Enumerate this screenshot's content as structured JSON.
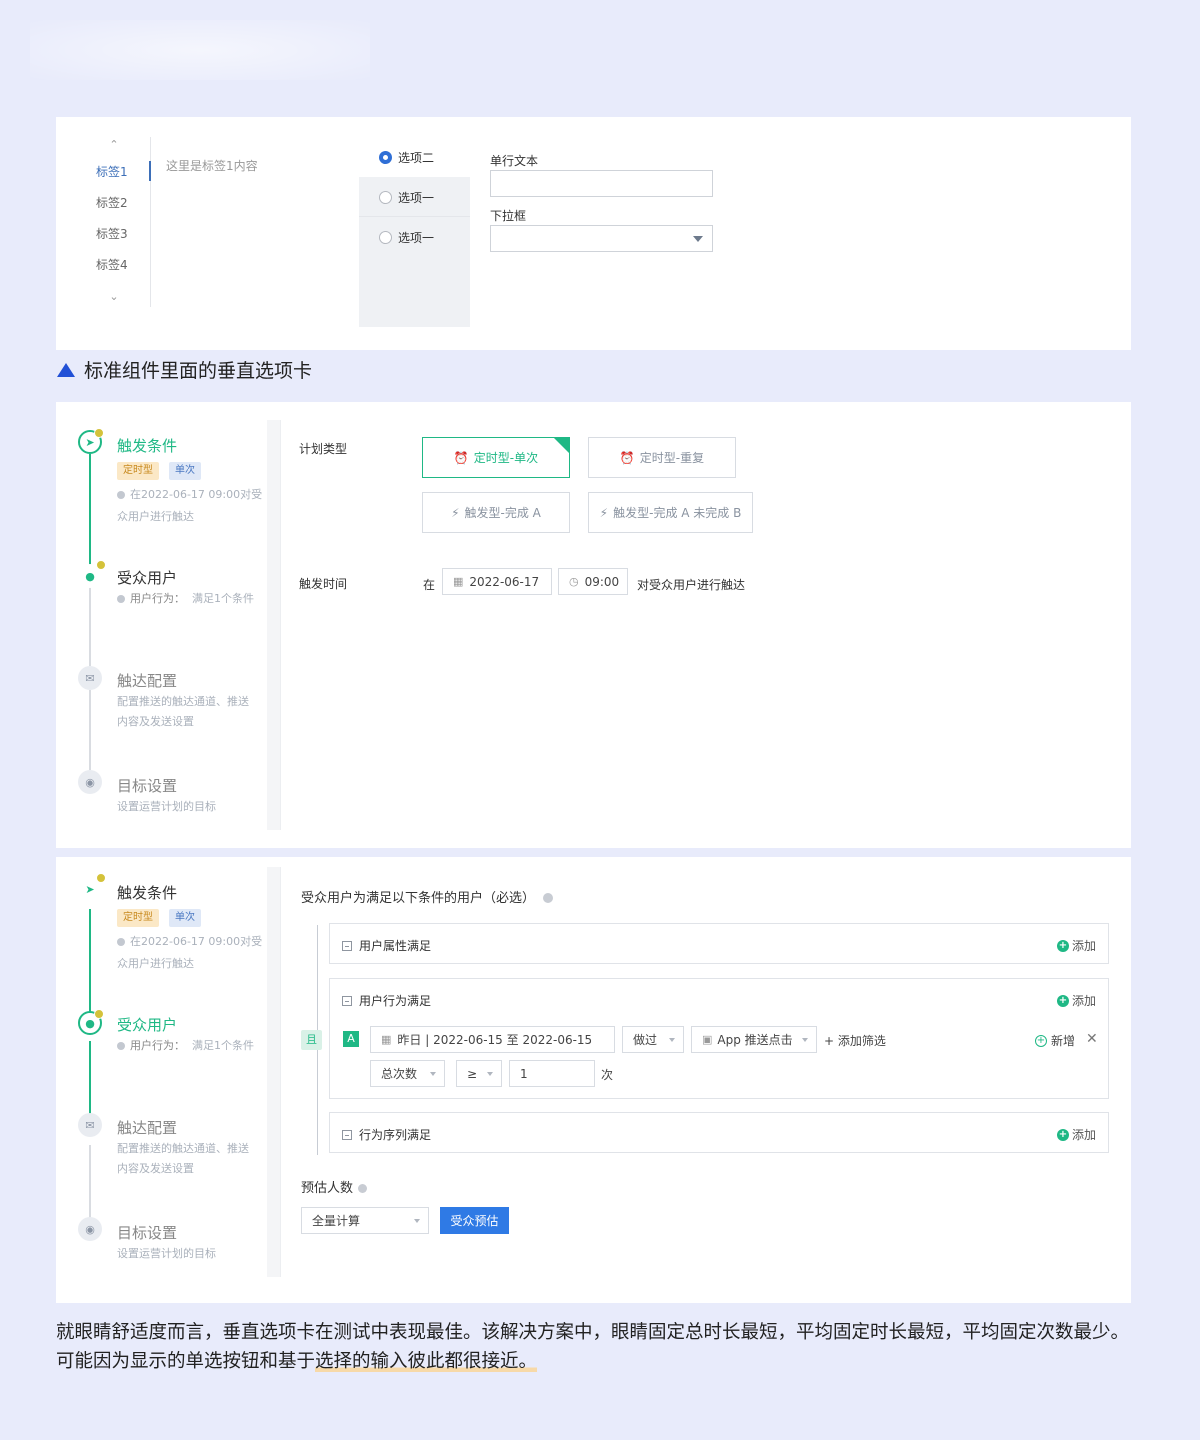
{
  "panel1": {
    "tabs": [
      "标签1",
      "标签2",
      "标签3",
      "标签4"
    ],
    "active_tab": 0,
    "tab_content": "这里是标签1内容",
    "radio_options": [
      "选项二",
      "选项一",
      "选项一"
    ],
    "selected_radio": 0,
    "text_field_label": "单行文本",
    "text_field_value": "",
    "select_label": "下拉框",
    "select_value": ""
  },
  "caption1": "标准组件里面的垂直选项卡",
  "steps": [
    {
      "title": "触发条件",
      "tags": [
        "定时型",
        "单次"
      ],
      "desc": "在2022-06-17 09:00对受众用户进行触达"
    },
    {
      "title": "受众用户",
      "desc_label": "用户行为：",
      "desc_value": "满足1个条件"
    },
    {
      "title": "触达配置",
      "desc": "配置推送的触达通道、推送内容及发送设置"
    },
    {
      "title": "目标设置",
      "desc": "设置运营计划的目标"
    }
  ],
  "panel2": {
    "plan_type_label": "计划类型",
    "options": [
      "定时型-单次",
      "定时型-重复",
      "触发型-完成 A",
      "触发型-完成 A 未完成 B"
    ],
    "selected_option": 0,
    "trigger_time_label": "触发时间",
    "at_label": "在",
    "date_value": "2022-06-17",
    "time_value": "09:00",
    "suffix": "对受众用户进行触达"
  },
  "panel3": {
    "title": "受众用户为满足以下条件的用户（必选）",
    "and_label": "且",
    "groups": [
      {
        "title": "用户属性满足",
        "add_label": "添加"
      },
      {
        "title": "用户行为满足",
        "add_label": "添加"
      },
      {
        "title": "行为序列满足",
        "add_label": "添加"
      }
    ],
    "rule": {
      "letter": "A",
      "date_range": "昨日 | 2022-06-15 至 2022-06-15",
      "action": "做过",
      "event": "App 推送点击",
      "add_filter": "添加筛选",
      "new_label": "新增",
      "metric": "总次数",
      "operator": "≥",
      "value": "1",
      "unit": "次"
    },
    "estimate_label": "预估人数",
    "estimate_select": "全量计算",
    "estimate_button": "受众预估"
  },
  "caption2_part1": "就眼睛舒适度而言，垂直选项卡在测试中表现最佳。该解决方案中，眼睛固定总时长最短，平均固定时长最短，平均固定次数最少。可能因为显示的单选按钮和基于",
  "caption2_part2": "选择的输入彼此都很接近。",
  "colors": {
    "background": "#e8ebfb",
    "green": "#1fb885",
    "blue": "#2f7ae5",
    "tab_active": "#3d6fb8"
  }
}
